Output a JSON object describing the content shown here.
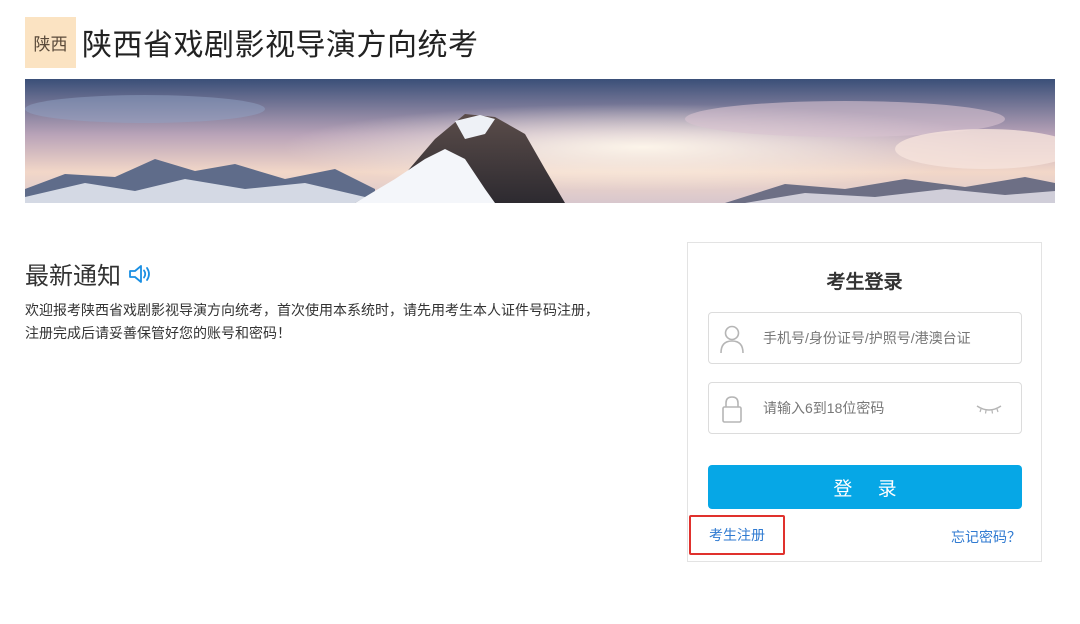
{
  "header": {
    "logo_text": "陕西",
    "site_title": "陕西省戏剧影视导演方向统考"
  },
  "notice": {
    "title": "最新通知",
    "speaker_icon": "speaker-icon",
    "text": "欢迎报考陕西省戏剧影视导演方向统考，首次使用本系统时，请先用考生本人证件号码注册，注册完成后请妥善保管好您的账号和密码！"
  },
  "login": {
    "title": "考生登录",
    "id_placeholder": "手机号/身份证号/护照号/港澳台证",
    "password_placeholder": "请输入6到18位密码",
    "submit_label": "登 录",
    "register_label": "考生注册",
    "forgot_label": "忘记密码？"
  },
  "colors": {
    "accent": "#06a7e6",
    "link": "#2f7ad1",
    "highlight_border": "#e0312d",
    "logo_bg": "#fbe3c2"
  }
}
